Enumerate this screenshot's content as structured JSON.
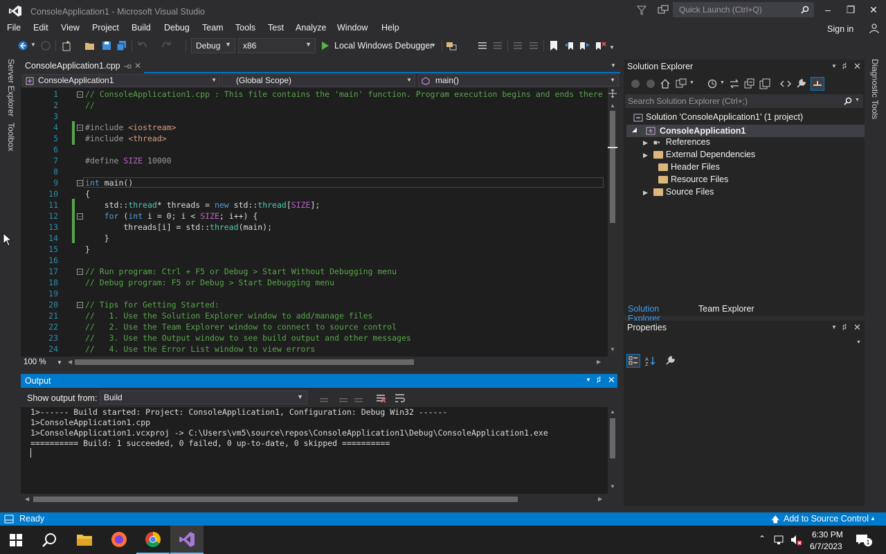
{
  "window": {
    "title": "ConsoleApplication1 - Microsoft Visual Studio",
    "quick_launch_placeholder": "Quick Launch (Ctrl+Q)"
  },
  "menu": {
    "items": [
      "File",
      "Edit",
      "View",
      "Project",
      "Build",
      "Debug",
      "Team",
      "Tools",
      "Test",
      "Analyze",
      "Window",
      "Help"
    ],
    "sign_in": "Sign in"
  },
  "toolbar": {
    "config": "Debug",
    "platform": "x86",
    "debugger": "Local Windows Debugger"
  },
  "left_tabs": [
    "Server Explorer",
    "Toolbox"
  ],
  "right_tabs": [
    "Diagnostic Tools"
  ],
  "editor": {
    "tab_label": "ConsoleApplication1.cpp",
    "nav_project": "ConsoleApplication1",
    "nav_scope": "(Global Scope)",
    "nav_member": "main()",
    "zoom": "100 %",
    "line_numbers": [
      "1",
      "2",
      "3",
      "4",
      "5",
      "6",
      "7",
      "8",
      "9",
      "10",
      "11",
      "12",
      "13",
      "14",
      "15",
      "16",
      "17",
      "18",
      "19",
      "20",
      "21",
      "22",
      "23",
      "24"
    ],
    "lines": {
      "l1": "// ConsoleApplication1.cpp : This file contains the 'main' function. Program execution begins and ends there",
      "l2": "//",
      "l4a": "#include",
      "l4b": " <iostream>",
      "l5a": "#include",
      "l5b": " <thread>",
      "l7a": "#define ",
      "l7b": "SIZE",
      "l7c": " 10000",
      "l9a": "int",
      "l9b": " main()",
      "l10": "{",
      "l11a": "    std::",
      "l11b": "thread",
      "l11c": "* threads = ",
      "l11d": "new",
      "l11e": " std::",
      "l11f": "thread",
      "l11g": "[",
      "l11h": "SIZE",
      "l11i": "];",
      "l12a": "    ",
      "l12b": "for",
      "l12c": " (",
      "l12d": "int",
      "l12e": " i = 0; i < ",
      "l12f": "SIZE",
      "l12g": "; i++) {",
      "l13a": "        threads[i] = std::",
      "l13b": "thread",
      "l13c": "(main);",
      "l14": "    }",
      "l15": "}",
      "l17": "// Run program: Ctrl + F5 or Debug > Start Without Debugging menu",
      "l18": "// Debug program: F5 or Debug > Start Debugging menu",
      "l20": "// Tips for Getting Started:",
      "l21": "//   1. Use the Solution Explorer window to add/manage files",
      "l22": "//   2. Use the Team Explorer window to connect to source control",
      "l23": "//   3. Use the Output window to see build output and other messages",
      "l24": "//   4. Use the Error List window to view errors"
    }
  },
  "output": {
    "title": "Output",
    "show_from_label": "Show output from:",
    "show_from_value": "Build",
    "lines": [
      "1>------ Build started: Project: ConsoleApplication1, Configuration: Debug Win32 ------",
      "1>ConsoleApplication1.cpp",
      "1>ConsoleApplication1.vcxproj -> C:\\Users\\vm5\\source\\repos\\ConsoleApplication1\\Debug\\ConsoleApplication1.exe",
      "========== Build: 1 succeeded, 0 failed, 0 up-to-date, 0 skipped =========="
    ]
  },
  "solution_explorer": {
    "title": "Solution Explorer",
    "search_placeholder": "Search Solution Explorer (Ctrl+;)",
    "solution": "Solution 'ConsoleApplication1' (1 project)",
    "project": "ConsoleApplication1",
    "items": [
      "References",
      "External Dependencies",
      "Header Files",
      "Resource Files",
      "Source Files"
    ],
    "tab_active": "Solution Explorer",
    "tab_other": "Team Explorer"
  },
  "properties": {
    "title": "Properties"
  },
  "status": {
    "ready": "Ready",
    "source_control": "Add to Source Control"
  },
  "taskbar": {
    "time": "6:30 PM",
    "date": "6/7/2023",
    "notification_count": "1"
  },
  "colors": {
    "accent": "#007acc",
    "comment": "#57a64a",
    "keyword": "#569cd6",
    "line_number": "#2b91af"
  }
}
